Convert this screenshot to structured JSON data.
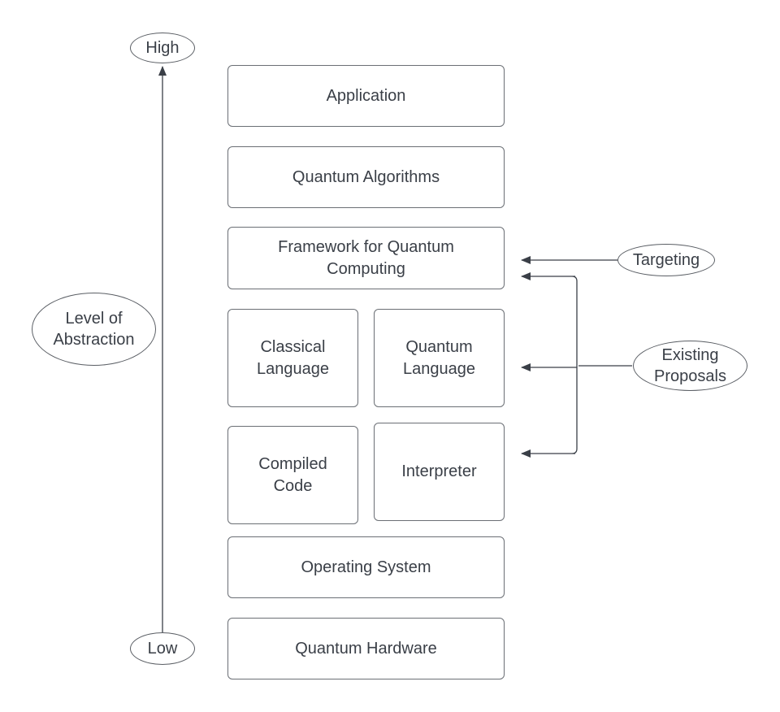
{
  "diagram": {
    "axis": {
      "high_label": "High",
      "low_label": "Low",
      "title": "Level of\nAbstraction"
    },
    "layers": {
      "application": "Application",
      "quantum_algorithms": "Quantum Algorithms",
      "framework": "Framework for Quantum\nComputing",
      "classical_language": "Classical\nLanguage",
      "quantum_language": "Quantum\nLanguage",
      "compiled_code": "Compiled\nCode",
      "interpreter": "Interpreter",
      "operating_system": "Operating System",
      "quantum_hardware": "Quantum Hardware"
    },
    "annotations": {
      "targeting": "Targeting",
      "existing_proposals": "Existing\nProposals"
    },
    "colors": {
      "stroke": "#3a3f47",
      "box_border": "#6b6f75",
      "text": "#3a3f47"
    }
  }
}
